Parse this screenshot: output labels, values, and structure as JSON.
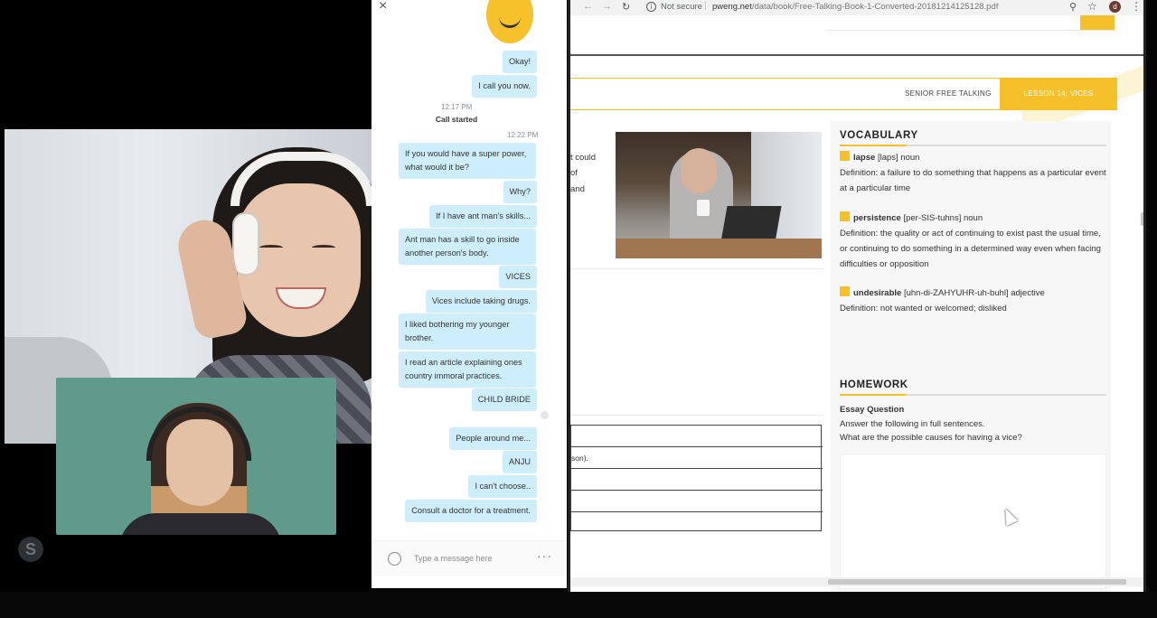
{
  "chat": {
    "messages": [
      {
        "text": "Okay!",
        "side": "right"
      },
      {
        "text": "I call you now.",
        "side": "right"
      },
      {
        "text": "If you would have a super power, what would it be?",
        "side": "left"
      },
      {
        "text": "Why?",
        "side": "right"
      },
      {
        "text": "If I have ant man's skills...",
        "side": "right"
      },
      {
        "text": "Ant man has a skill to go inside another person's body.",
        "side": "left"
      },
      {
        "text": "VICES",
        "side": "right"
      },
      {
        "text": "Vices include taking drugs.",
        "side": "right"
      },
      {
        "text": "I liked bothering my younger brother.",
        "side": "left"
      },
      {
        "text": "I read an article explaining ones country immoral practices.",
        "side": "left"
      },
      {
        "text": "CHILD BRIDE",
        "side": "right"
      },
      {
        "text": "People around me...",
        "side": "right"
      },
      {
        "text": "ANJU",
        "side": "right"
      },
      {
        "text": "I can't choose..",
        "side": "right"
      },
      {
        "text": "Consult a doctor for a treatment.",
        "side": "right"
      }
    ],
    "time1": "12:17 PM",
    "call_started": "Call started",
    "time2": "12:22 PM",
    "compose_placeholder": "Type a message here",
    "more_label": "···",
    "close_label": "×"
  },
  "browser": {
    "security": "Not secure",
    "url_host": "pweng.net",
    "url_path": "/data/book/Free-Talking-Book-1-Converted-20181214125128.pdf",
    "avatar_letter": "d"
  },
  "pdf": {
    "header_series": "SENIOR FREE TALKING",
    "header_lesson": "LESSON 14: VICES",
    "left_fragments": [
      "t could",
      "of",
      "and"
    ],
    "table_fragment": "son).",
    "vocab_title": "VOCABULARY",
    "vocab": [
      {
        "word": "lapse",
        "pron": "[laps]",
        "pos": "noun",
        "definition": "Definition: a failure to do something that happens as a particular event at a particular time"
      },
      {
        "word": "persistence",
        "pron": "[per-SIS-tuhns]",
        "pos": "noun",
        "definition": "Definition: the quality or act of continuing to exist past the usual time, or continuing to do something in a determined way even when facing difficulties or opposition"
      },
      {
        "word": "undesirable",
        "pron": "[uhn-di-ZAHYUHR-uh-buhl]",
        "pos": "adjective",
        "definition": "Definition: not wanted or welcomed; disliked"
      }
    ],
    "homework_title": "HOMEWORK",
    "essay_title": "Essay Question",
    "essay_instruction": "Answer the following in full sentences.",
    "essay_question": "What are the possible causes for having a vice?"
  },
  "colors": {
    "accent": "#f5c02a",
    "chat_bubble": "#cfeefb"
  }
}
